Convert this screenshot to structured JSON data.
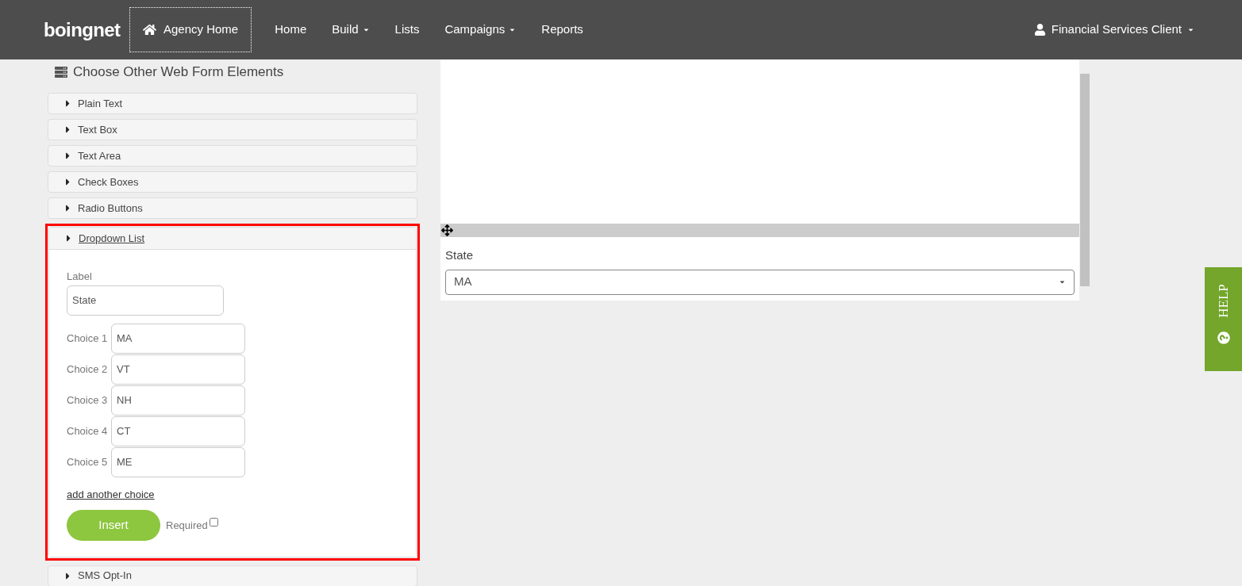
{
  "navbar": {
    "logo": "boingnet",
    "agency_home": "Agency Home",
    "items": [
      {
        "label": "Home",
        "dropdown": false
      },
      {
        "label": "Build",
        "dropdown": true
      },
      {
        "label": "Lists",
        "dropdown": false
      },
      {
        "label": "Campaigns",
        "dropdown": true
      },
      {
        "label": "Reports",
        "dropdown": false
      }
    ],
    "user": {
      "label": "Financial Services Client",
      "dropdown": true
    }
  },
  "panel": {
    "title": "Choose Other Web Form Elements",
    "elements": [
      {
        "label": "Plain Text",
        "expanded": false,
        "highlighted": false
      },
      {
        "label": "Text Box",
        "expanded": false,
        "highlighted": false
      },
      {
        "label": "Text Area",
        "expanded": false,
        "highlighted": false
      },
      {
        "label": "Check Boxes",
        "expanded": false,
        "highlighted": false
      },
      {
        "label": "Radio Buttons",
        "expanded": false,
        "highlighted": false
      },
      {
        "label": "Dropdown List",
        "expanded": true,
        "highlighted": true
      },
      {
        "label": "SMS Opt-In",
        "expanded": false,
        "highlighted": false
      }
    ]
  },
  "dropdown_editor": {
    "label_caption": "Label",
    "label_value": "State",
    "choices": [
      {
        "caption": "Choice 1",
        "value": "MA"
      },
      {
        "caption": "Choice 2",
        "value": "VT"
      },
      {
        "caption": "Choice 3",
        "value": "NH"
      },
      {
        "caption": "Choice 4",
        "value": "CT"
      },
      {
        "caption": "Choice 5",
        "value": "ME"
      }
    ],
    "add_link": "add another choice",
    "insert_button": "Insert",
    "required_label": "Required",
    "required_checked": false
  },
  "preview": {
    "field_label": "State",
    "selected_value": "MA"
  },
  "help_tab": {
    "label": "HELP"
  }
}
